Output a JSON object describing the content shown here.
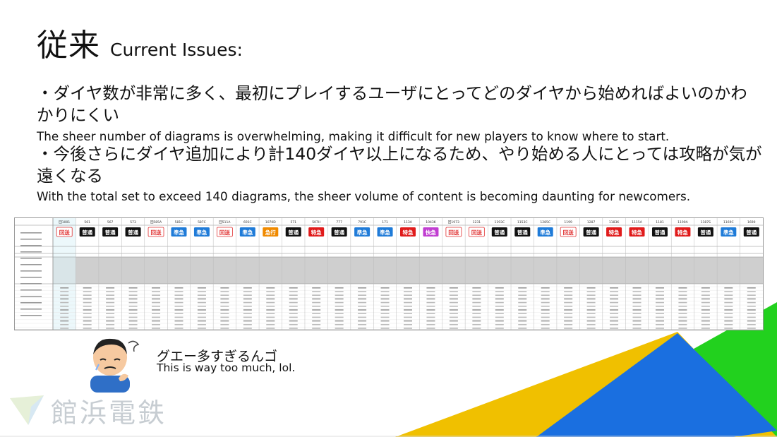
{
  "title": {
    "jp": "従来",
    "en": "Current Issues:"
  },
  "bullets": [
    {
      "jp": "・ダイヤ数が非常に多く、最初にプレイするユーザにとってどのダイヤから始めればよいのかわかりにくい",
      "en": "The sheer number of diagrams is overwhelming, making it difficult for new players to know where to start."
    },
    {
      "jp": "・今後さらにダイヤ追加により計140ダイヤ以上になるため、やり始める人にとっては攻略が気が遠くなる",
      "en": "With the total set to exceed 140 diagrams, the sheer volume of content is becoming daunting for newcomers."
    }
  ],
  "table": {
    "train_numbers": [
      "回1001",
      "561",
      "567",
      "573",
      "回585A",
      "581C",
      "587C",
      "回511A",
      "691C",
      "1070D",
      "571",
      "507H",
      "777",
      "791C",
      "171",
      "113A",
      "1043K",
      "回1973",
      "1231",
      "1193C",
      "1153C",
      "1285C",
      "1199",
      "1287",
      "1183K",
      "1115A",
      "1181",
      "1190A",
      "1187S",
      "1169C",
      "1690"
    ],
    "types": [
      "回送",
      "普通",
      "普通",
      "普通",
      "回送",
      "準急",
      "準急",
      "回送",
      "準急",
      "急行",
      "普通",
      "特急",
      "普通",
      "準急",
      "準急",
      "特急",
      "快急",
      "回送",
      "回送",
      "普通",
      "普通",
      "準急",
      "回送",
      "普通",
      "特急",
      "特急",
      "普通",
      "特急",
      "普通",
      "準急",
      "普通"
    ],
    "type_colors": [
      "#ffffff",
      "#111111",
      "#111111",
      "#111111",
      "#ffffff",
      "#1f7bd8",
      "#1f7bd8",
      "#ffffff",
      "#1f7bd8",
      "#f08a00",
      "#111111",
      "#e01b1b",
      "#111111",
      "#1f7bd8",
      "#1f7bd8",
      "#e01b1b",
      "#c13ed1",
      "#ffffff",
      "#ffffff",
      "#111111",
      "#111111",
      "#1f7bd8",
      "#ffffff",
      "#111111",
      "#e01b1b",
      "#e01b1b",
      "#111111",
      "#e01b1b",
      "#111111",
      "#1f7bd8",
      "#111111"
    ]
  },
  "speech": {
    "jp": "グエー多すぎるんゴ",
    "en": "This is way too much, lol."
  },
  "logo": {
    "text": "館浜電鉄"
  },
  "colors": {
    "yellow": "#f0c000",
    "blue": "#1a6fe0",
    "green": "#22d11e"
  }
}
